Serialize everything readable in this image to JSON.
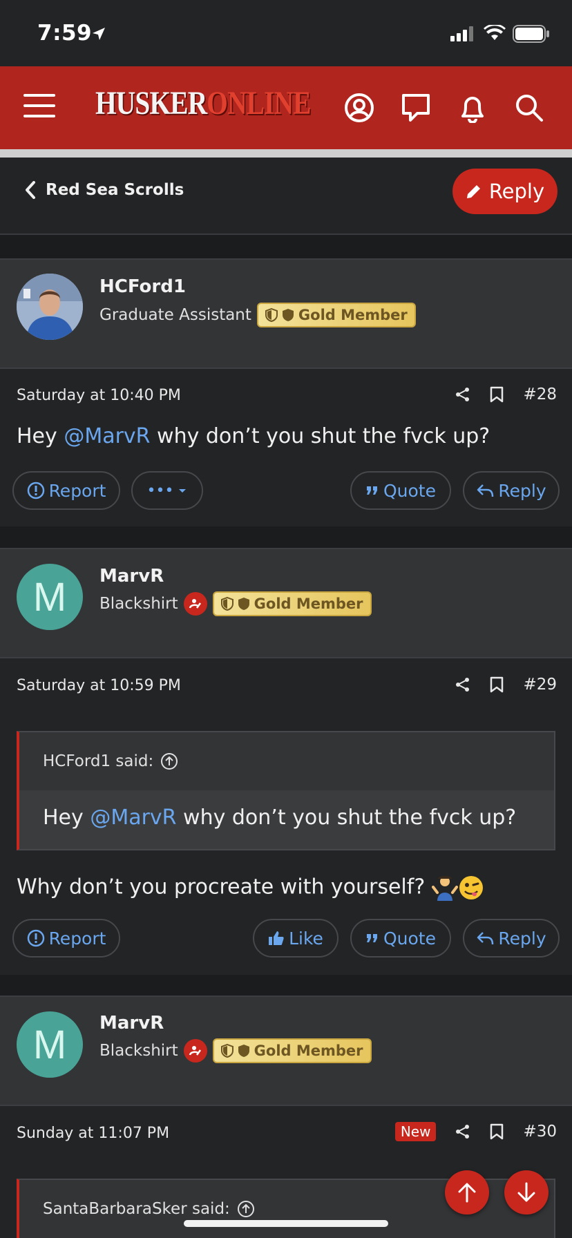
{
  "status": {
    "time": "7:59"
  },
  "header": {
    "logo_part1": "HUSKER",
    "logo_part2": "ONLINE"
  },
  "thread": {
    "back_label": "Red Sea Scrolls",
    "reply_label": "Reply"
  },
  "posts": [
    {
      "username": "HCFord1",
      "user_title": "Graduate Assistant",
      "badge": "Gold Member",
      "date": "Saturday at 10:40 PM",
      "number": "#28",
      "text_prefix": "Hey ",
      "mention": "@MarvR",
      "text_suffix": " why don’t you shut the fvck up?",
      "actions": {
        "report": "Report",
        "more": "•••",
        "quote": "Quote",
        "reply": "Reply"
      }
    },
    {
      "username": "MarvR",
      "avatar_letter": "M",
      "user_title": "Blackshirt",
      "badge": "Gold Member",
      "date": "Saturday at 10:59 PM",
      "number": "#29",
      "quote": {
        "author": "HCFord1 said:",
        "text_prefix": "Hey ",
        "mention": "@MarvR",
        "text_suffix": " why don’t you shut the fvck up?"
      },
      "text": "Why don’t you procreate with yourself?",
      "actions": {
        "report": "Report",
        "like": "Like",
        "quote": "Quote",
        "reply": "Reply"
      }
    },
    {
      "username": "MarvR",
      "avatar_letter": "M",
      "user_title": "Blackshirt",
      "badge": "Gold Member",
      "date": "Sunday at 11:07 PM",
      "new_label": "New",
      "number": "#30",
      "quote": {
        "author": "SantaBarbaraSker said:"
      }
    }
  ],
  "colors": {
    "brand_red": "#b0261f",
    "link_blue": "#6aa7ef",
    "gold": "#e6c55d",
    "avatar_teal": "#4aa397"
  }
}
